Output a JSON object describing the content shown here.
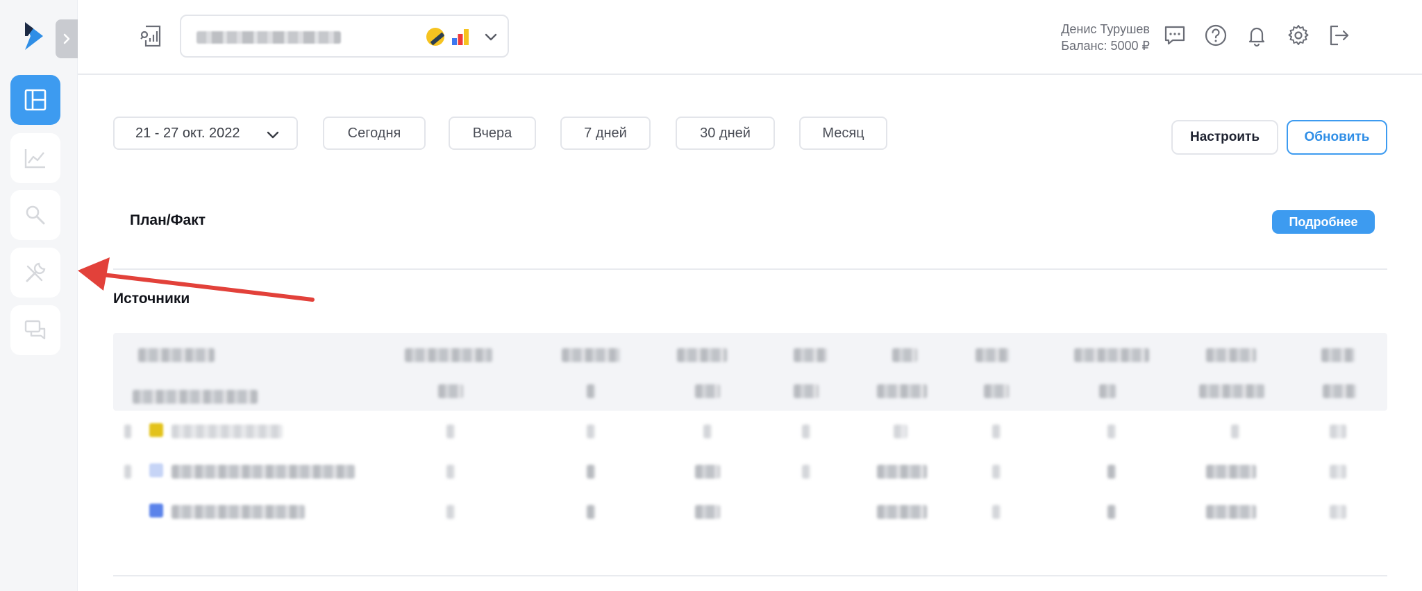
{
  "sidebar": {
    "items": [
      {
        "name": "dashboard",
        "active": true
      },
      {
        "name": "analytics",
        "active": false
      },
      {
        "name": "search",
        "active": false
      },
      {
        "name": "tools",
        "active": false
      },
      {
        "name": "messages",
        "active": false
      }
    ],
    "collapse_icon": "chevron-right-icon"
  },
  "header": {
    "user_name": "Денис Турушев",
    "balance": "Баланс: 5000 ₽",
    "icons": [
      "chat-icon",
      "help-icon",
      "bell-icon",
      "gear-icon",
      "logout-icon"
    ]
  },
  "filters": {
    "date_range": "21 - 27 окт. 2022",
    "presets": [
      "Сегодня",
      "Вчера",
      "7 дней",
      "30 дней",
      "Месяц"
    ],
    "configure_label": "Настроить",
    "refresh_label": "Обновить"
  },
  "sections": {
    "plan_fact_title": "План/Факт",
    "more_label": "Подробнее",
    "sources_title": "Источники"
  },
  "colors": {
    "accent": "#3d9bf0",
    "arrow": "#e2413a"
  }
}
